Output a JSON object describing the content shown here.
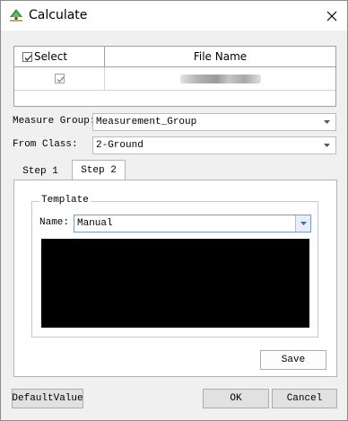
{
  "window": {
    "title": "Calculate",
    "app_icon": "tree-icon",
    "close_icon": "close-icon"
  },
  "file_table": {
    "columns": [
      "Select",
      "File Name"
    ],
    "header_select_checked": true,
    "rows": [
      {
        "selected": true,
        "file_name_redacted": true
      }
    ]
  },
  "form": {
    "measure_group_label": "Measure Group:",
    "measure_group_value": "Measurement_Group",
    "from_class_label": "From Class:",
    "from_class_value": "2-Ground"
  },
  "tabs": {
    "items": [
      "Step 1",
      "Step 2"
    ],
    "active": "Step 2"
  },
  "template": {
    "group_label": "Template",
    "name_label": "Name:",
    "name_value": "Manual",
    "save_label": "Save"
  },
  "footer": {
    "default_label": "DefaultValue",
    "ok_label": "OK",
    "cancel_label": "Cancel"
  }
}
